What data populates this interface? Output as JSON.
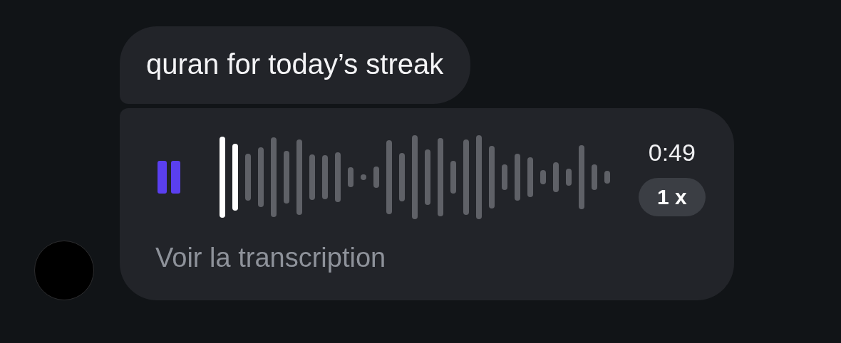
{
  "messages": [
    {
      "kind": "text",
      "text": "quran for today’s streak"
    },
    {
      "kind": "voice",
      "playing": true,
      "level": 0.06,
      "duration": "0:49",
      "speed": "1 x",
      "transcript_link": "Voir la transcription"
    }
  ]
}
